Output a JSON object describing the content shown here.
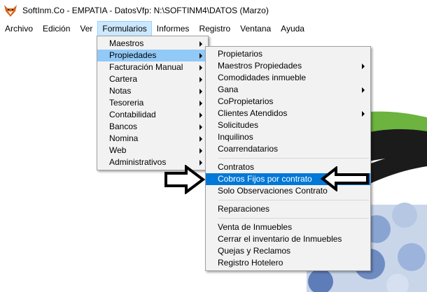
{
  "window": {
    "title": "SoftInm.Co - EMPATIA - DatosVfp: N:\\SOFTINM4\\DATOS  (Marzo)"
  },
  "menubar": {
    "items": [
      {
        "label": "Archivo"
      },
      {
        "label": "Edición"
      },
      {
        "label": "Ver"
      },
      {
        "label": "Formularios"
      },
      {
        "label": "Informes"
      },
      {
        "label": "Registro"
      },
      {
        "label": "Ventana"
      },
      {
        "label": "Ayuda"
      }
    ]
  },
  "formularios_menu": {
    "items": [
      {
        "label": "Maestros"
      },
      {
        "label": "Propiedades"
      },
      {
        "label": "Facturación Manual"
      },
      {
        "label": "Cartera"
      },
      {
        "label": "Notas"
      },
      {
        "label": "Tesoreria"
      },
      {
        "label": "Contabilidad"
      },
      {
        "label": "Bancos"
      },
      {
        "label": "Nomina"
      },
      {
        "label": "Web"
      },
      {
        "label": "Administrativos"
      }
    ]
  },
  "propiedades_menu": {
    "group1": [
      {
        "label": "Propietarios"
      },
      {
        "label": "Maestros Propiedades"
      },
      {
        "label": "Comodidades inmueble"
      },
      {
        "label": "Gana"
      },
      {
        "label": "CoPropietarios"
      },
      {
        "label": "Clientes Atendidos"
      },
      {
        "label": "Solicitudes"
      },
      {
        "label": "Inquilinos"
      },
      {
        "label": "Coarrendatarios"
      }
    ],
    "group2": [
      {
        "label": "Contratos"
      },
      {
        "label": "Cobros Fijos por contrato"
      },
      {
        "label": "Solo Observaciones Contrato"
      }
    ],
    "group3": [
      {
        "label": "Reparaciones"
      }
    ],
    "group4": [
      {
        "label": "Venta de Inmuebles"
      },
      {
        "label": "Cerrar el inventario de Inmuebles"
      },
      {
        "label": "Quejas y Reclamos"
      },
      {
        "label": "Registro Hotelero"
      }
    ]
  },
  "colors": {
    "highlight": "#0078d7",
    "selected": "#91c9f7",
    "menu_bg": "#f2f2f2"
  }
}
